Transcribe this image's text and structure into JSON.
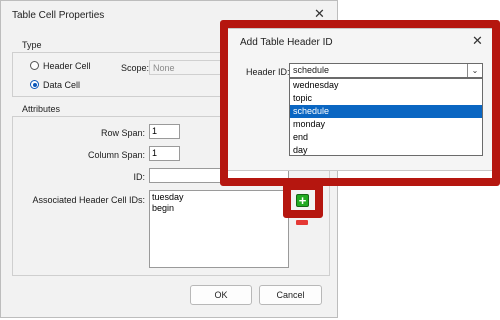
{
  "back_dialog": {
    "title": "Table Cell Properties",
    "close_glyph": "✕",
    "type_group": {
      "label": "Type",
      "header_cell": "Header Cell",
      "data_cell": "Data Cell",
      "selected": "Data Cell",
      "scope_label": "Scope:",
      "scope_value": "None"
    },
    "attributes_group": {
      "label": "Attributes",
      "row_span_label": "Row Span:",
      "row_span_value": "1",
      "column_span_label": "Column Span:",
      "column_span_value": "1",
      "id_label": "ID:",
      "id_value": "",
      "assoc_label": "Associated Header Cell IDs:",
      "assoc_items": [
        "tuesday",
        "begin"
      ]
    },
    "add_icon_glyph": "+",
    "ok_label": "OK",
    "cancel_label": "Cancel"
  },
  "front_dialog": {
    "title": "Add Table Header ID",
    "close_glyph": "✕",
    "header_id_label": "Header ID:",
    "selected_value": "schedule",
    "dropdown_glyph": "⌄",
    "options": [
      "wednesday",
      "topic",
      "schedule",
      "monday",
      "end",
      "day"
    ]
  },
  "colors": {
    "highlight": "#b5160f",
    "selection": "#0a66c2",
    "add_green": "#22aa22",
    "remove_red": "#e53935"
  }
}
